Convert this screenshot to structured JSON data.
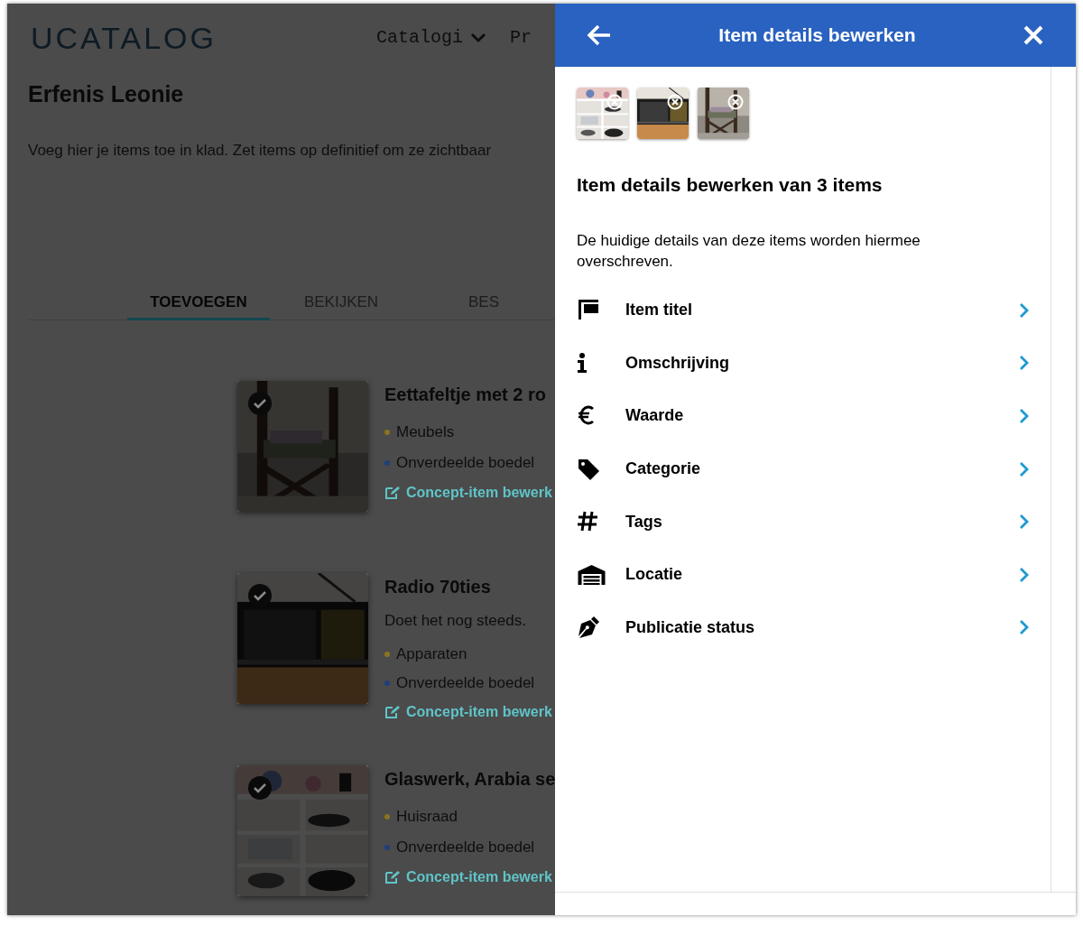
{
  "header": {
    "logo": "UCATALOG",
    "nav": [
      {
        "label": "Catalogi",
        "dropdown": true
      },
      {
        "label": "Pr",
        "dropdown": false
      }
    ]
  },
  "page": {
    "title": "Erfenis Leonie",
    "intro": "Voeg hier je items toe in klad. Zet items op definitief om ze zichtbaar"
  },
  "tabs": [
    {
      "label": "TOEVOEGEN",
      "selected": true
    },
    {
      "label": "BEKIJKEN",
      "selected": false
    },
    {
      "label": "BES",
      "selected": false
    }
  ],
  "items": [
    {
      "title": "Eettafeltje met 2 ro",
      "selected": true,
      "tags": [
        {
          "label": "Meubels",
          "color": "#8a7420"
        },
        {
          "label": "Onverdeelde boedel",
          "color": "#1f3f7a"
        }
      ],
      "edit_link": "Concept-item bewerk"
    },
    {
      "title": "Radio 70ties",
      "description": "Doet het nog steeds.",
      "selected": true,
      "tags": [
        {
          "label": "Apparaten",
          "color": "#8a7420"
        },
        {
          "label": "Onverdeelde boedel",
          "color": "#1f3f7a"
        }
      ],
      "edit_link": "Concept-item bewerk"
    },
    {
      "title": "Glaswerk, Arabia se",
      "selected": true,
      "tags": [
        {
          "label": "Huisraad",
          "color": "#8a7420"
        },
        {
          "label": "Onverdeelde boedel",
          "color": "#1f3f7a"
        }
      ],
      "edit_link": "Concept-item bewerk"
    }
  ],
  "drawer": {
    "title": "Item details bewerken",
    "heading": "Item details bewerken van 3 items",
    "description": "De huidige details van deze items worden hiermee overschreven.",
    "options": [
      {
        "kind": "title",
        "label": "Item titel"
      },
      {
        "kind": "description",
        "label": "Omschrijving"
      },
      {
        "kind": "value",
        "label": "Waarde"
      },
      {
        "kind": "category",
        "label": "Categorie"
      },
      {
        "kind": "tags",
        "label": "Tags"
      },
      {
        "kind": "location",
        "label": "Locatie"
      },
      {
        "kind": "status",
        "label": "Publicatie status"
      }
    ]
  }
}
